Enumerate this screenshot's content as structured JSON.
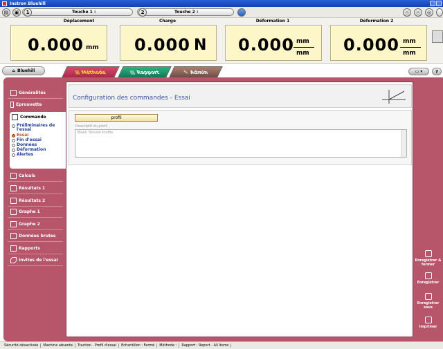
{
  "window": {
    "title": "Instron Bluehill"
  },
  "toolbar": {
    "touche1_number": "1",
    "touche1_label": "Touche 1 :",
    "touche2_number": "2",
    "touche2_label": "Touche 2 :"
  },
  "readouts": [
    {
      "title": "Déplacement",
      "value": "0.000",
      "unit": "mm"
    },
    {
      "title": "Charge",
      "value": "0.000",
      "unit": "N"
    },
    {
      "title": "Déformation 1",
      "value": "0.000",
      "unit_num": "mm",
      "unit_den": "mm"
    },
    {
      "title": "Déformation 2",
      "value": "0.000",
      "unit_num": "mm",
      "unit_den": "mm"
    }
  ],
  "tabs": {
    "bluehill": "Bluehill",
    "methode": "Méthode",
    "rapport": "Rapport",
    "admin": "Admin",
    "help": "?"
  },
  "sidebar": {
    "items": [
      {
        "label": "Généralités"
      },
      {
        "label": "Eprouvette"
      },
      {
        "label": "Commande"
      },
      {
        "label": "Calculs"
      },
      {
        "label": "Résultats 1"
      },
      {
        "label": "Résultats 2"
      },
      {
        "label": "Graphe 1"
      },
      {
        "label": "Graphe 2"
      },
      {
        "label": "Données brutes"
      },
      {
        "label": "Rapports"
      },
      {
        "label": "Invites de l'essai"
      }
    ],
    "commande_subitems": [
      {
        "label": "Préliminaires de l'essai",
        "active": false
      },
      {
        "label": "Essai",
        "active": true
      },
      {
        "label": "Fin d'essai",
        "active": false
      },
      {
        "label": "Données",
        "active": false
      },
      {
        "label": "Déformation",
        "active": false
      },
      {
        "label": "Alertes",
        "active": false
      }
    ]
  },
  "content": {
    "title": "Configuration des commandes - Essai",
    "profil_button": "profil",
    "desc_label": "Descriptif du profil",
    "desc_value": "Blank Tension Profile"
  },
  "actions": {
    "save_close": "Enregistrer & fermer",
    "save": "Enregistrer",
    "save_as": "Enregistrer sous",
    "print": "Imprimer"
  },
  "statusbar": [
    "Sécurité désactivée",
    "Machine absente",
    "Traction - Profil d'essai",
    "Echantillon : Fermé",
    "Méthode :",
    "Rapport : Report - All Items"
  ],
  "colors": {
    "accent_maroon": "#b7556b",
    "readout_bg": "#fdf6c8",
    "title_blue": "#3a56a8",
    "active_item": "#e07a2e"
  }
}
